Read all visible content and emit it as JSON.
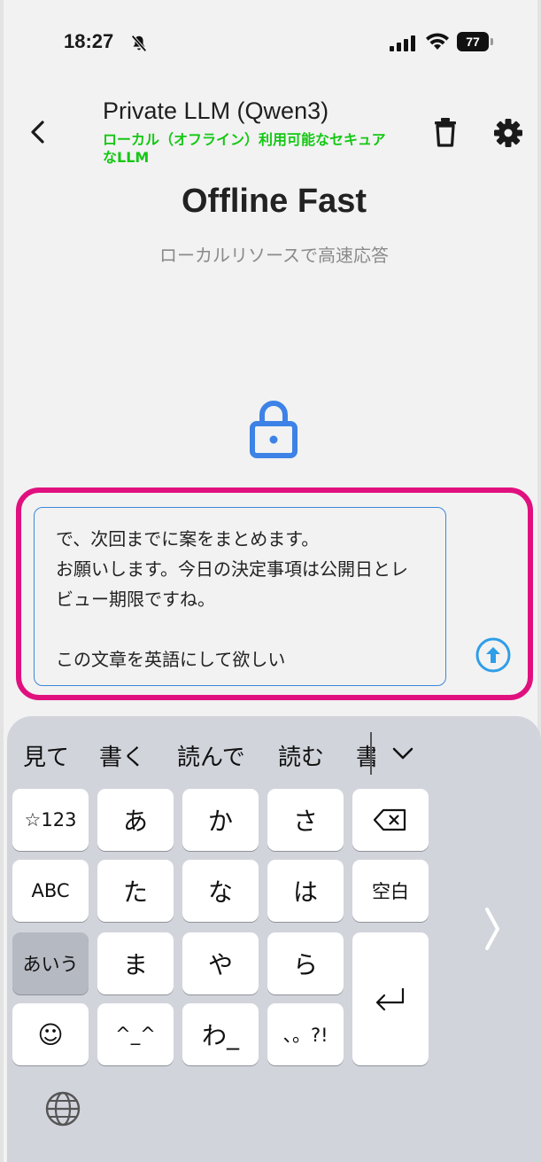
{
  "status_bar": {
    "time": "18:27",
    "battery": "77"
  },
  "header": {
    "title": "Private LLM (Qwen3)",
    "subtitle": "ローカル（オフライン）利用可能なセキュアなLLM"
  },
  "hero": {
    "title": "Offline Fast",
    "subtitle": "ローカルリソースで高速応答"
  },
  "input": {
    "text": "で、次回までに案をまとめます。\nお願いします。今日の決定事項は公開日とレビュー期限ですね。\n\nこの文章を英語にして欲しい"
  },
  "keyboard": {
    "candidates": [
      "見て",
      "書く",
      "読んで",
      "読む",
      "書"
    ],
    "keys": {
      "sym": "☆123",
      "a": "あ",
      "ka": "か",
      "sa": "さ",
      "abc": "ABC",
      "ta": "た",
      "na": "な",
      "ha": "は",
      "space": "空白",
      "aiu": "あいう",
      "ma": "ま",
      "ya": "や",
      "ra": "ら",
      "emoji": "☺",
      "kaomoji": "^_^",
      "wa": "わ_",
      "punct": "、。?!"
    }
  },
  "colors": {
    "accent_green": "#14c814",
    "highlight_magenta": "#e0117e",
    "input_border": "#3c88d8",
    "lock_blue": "#3d82e6",
    "send_blue": "#2f9ee8"
  }
}
